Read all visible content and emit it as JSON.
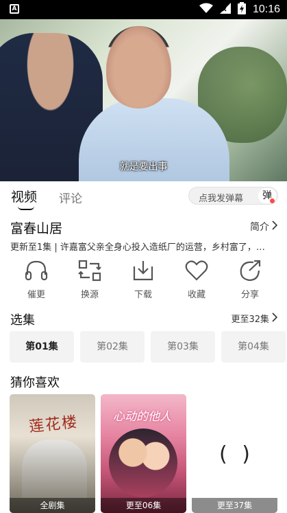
{
  "status_bar": {
    "time": "10:16",
    "left_icon": "A"
  },
  "video": {
    "subtitle": "就是要出事"
  },
  "tabs": [
    {
      "label": "视频",
      "active": true
    },
    {
      "label": "评论",
      "active": false
    }
  ],
  "danmaku": {
    "placeholder": "点我发弹幕",
    "button": "弹"
  },
  "show": {
    "title": "富春山居",
    "intro_link": "简介",
    "update_info": "更新至1集 | 许嘉富父亲全身心投入造纸厂的运营，乡村富了，…"
  },
  "actions": [
    {
      "label": "催更",
      "icon": "headphones-icon"
    },
    {
      "label": "换源",
      "icon": "switch-source-icon"
    },
    {
      "label": "下载",
      "icon": "download-icon"
    },
    {
      "label": "收藏",
      "icon": "heart-icon"
    },
    {
      "label": "分享",
      "icon": "share-icon"
    }
  ],
  "episodes": {
    "title": "选集",
    "more": "更至32集",
    "items": [
      "第01集",
      "第02集",
      "第03集",
      "第04集"
    ]
  },
  "recommend": {
    "title": "猜你喜欢",
    "items": [
      {
        "poster_text": "莲花楼",
        "badge": "全剧集"
      },
      {
        "poster_text": "心动的他人",
        "badge": "更至06集"
      },
      {
        "poster_text": "( )",
        "badge": "更至37集"
      }
    ]
  },
  "colors": {
    "accent": "#ff4a4a",
    "text": "#111111",
    "muted": "#777777"
  }
}
